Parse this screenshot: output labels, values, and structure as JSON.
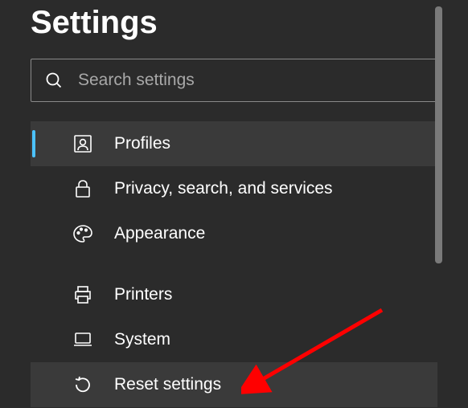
{
  "header": {
    "title": "Settings"
  },
  "search": {
    "placeholder": "Search settings"
  },
  "nav": {
    "items": [
      {
        "label": "Profiles"
      },
      {
        "label": "Privacy, search, and services"
      },
      {
        "label": "Appearance"
      },
      {
        "label": "Printers"
      },
      {
        "label": "System"
      },
      {
        "label": "Reset settings"
      }
    ]
  },
  "colors": {
    "background": "#2b2b2b",
    "item_hover": "#3a3a3a",
    "accent": "#4cc2ff",
    "text": "#ffffff",
    "placeholder": "#a8a8a8",
    "arrow": "#ff0000"
  }
}
